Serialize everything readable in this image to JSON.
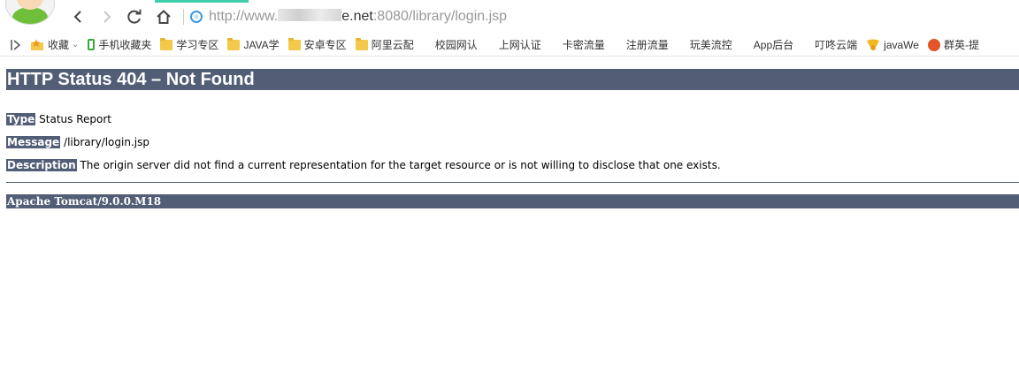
{
  "browser": {
    "url_prefix": "http://www.",
    "url_host_suffix": "e.net",
    "url_path": ":8080/library/login.jsp",
    "bookmarks": [
      {
        "label": "收藏",
        "icon": "star-folder-icon",
        "dropdown": "⌄"
      },
      {
        "label": "手机收藏夹",
        "icon": "phone-icon"
      },
      {
        "label": "学习专区",
        "icon": "folder-icon"
      },
      {
        "label": "JAVA学",
        "icon": "folder-icon"
      },
      {
        "label": "安卓专区",
        "icon": "folder-icon"
      },
      {
        "label": "阿里云配",
        "icon": "folder-icon"
      },
      {
        "label": "校园网认",
        "icon": "page-icon"
      },
      {
        "label": "上网认证",
        "icon": "page-icon"
      },
      {
        "label": "卡密流量",
        "icon": "page-icon"
      },
      {
        "label": "注册流量",
        "icon": "page-icon"
      },
      {
        "label": "玩美流控",
        "icon": "page-icon"
      },
      {
        "label": "App后台",
        "icon": "page-icon"
      },
      {
        "label": "叮咚云端",
        "icon": "page-icon"
      },
      {
        "label": "javaWe",
        "icon": "badge-icon"
      },
      {
        "label": "群英-提",
        "icon": "round-logo-icon"
      }
    ]
  },
  "error_page": {
    "title": "HTTP Status 404 – Not Found",
    "type_label": "Type",
    "type_value": "Status Report",
    "message_label": "Message",
    "message_value": "/library/login.jsp",
    "description_label": "Description",
    "description_value": "The origin server did not find a current representation for the target resource or is not willing to disclose that one exists.",
    "server_footer": "Apache Tomcat/9.0.0.M18"
  },
  "colors": {
    "tomcat_header": "#525d76",
    "tab_accent": "#3fcfa8",
    "folder": "#f3c94b"
  }
}
